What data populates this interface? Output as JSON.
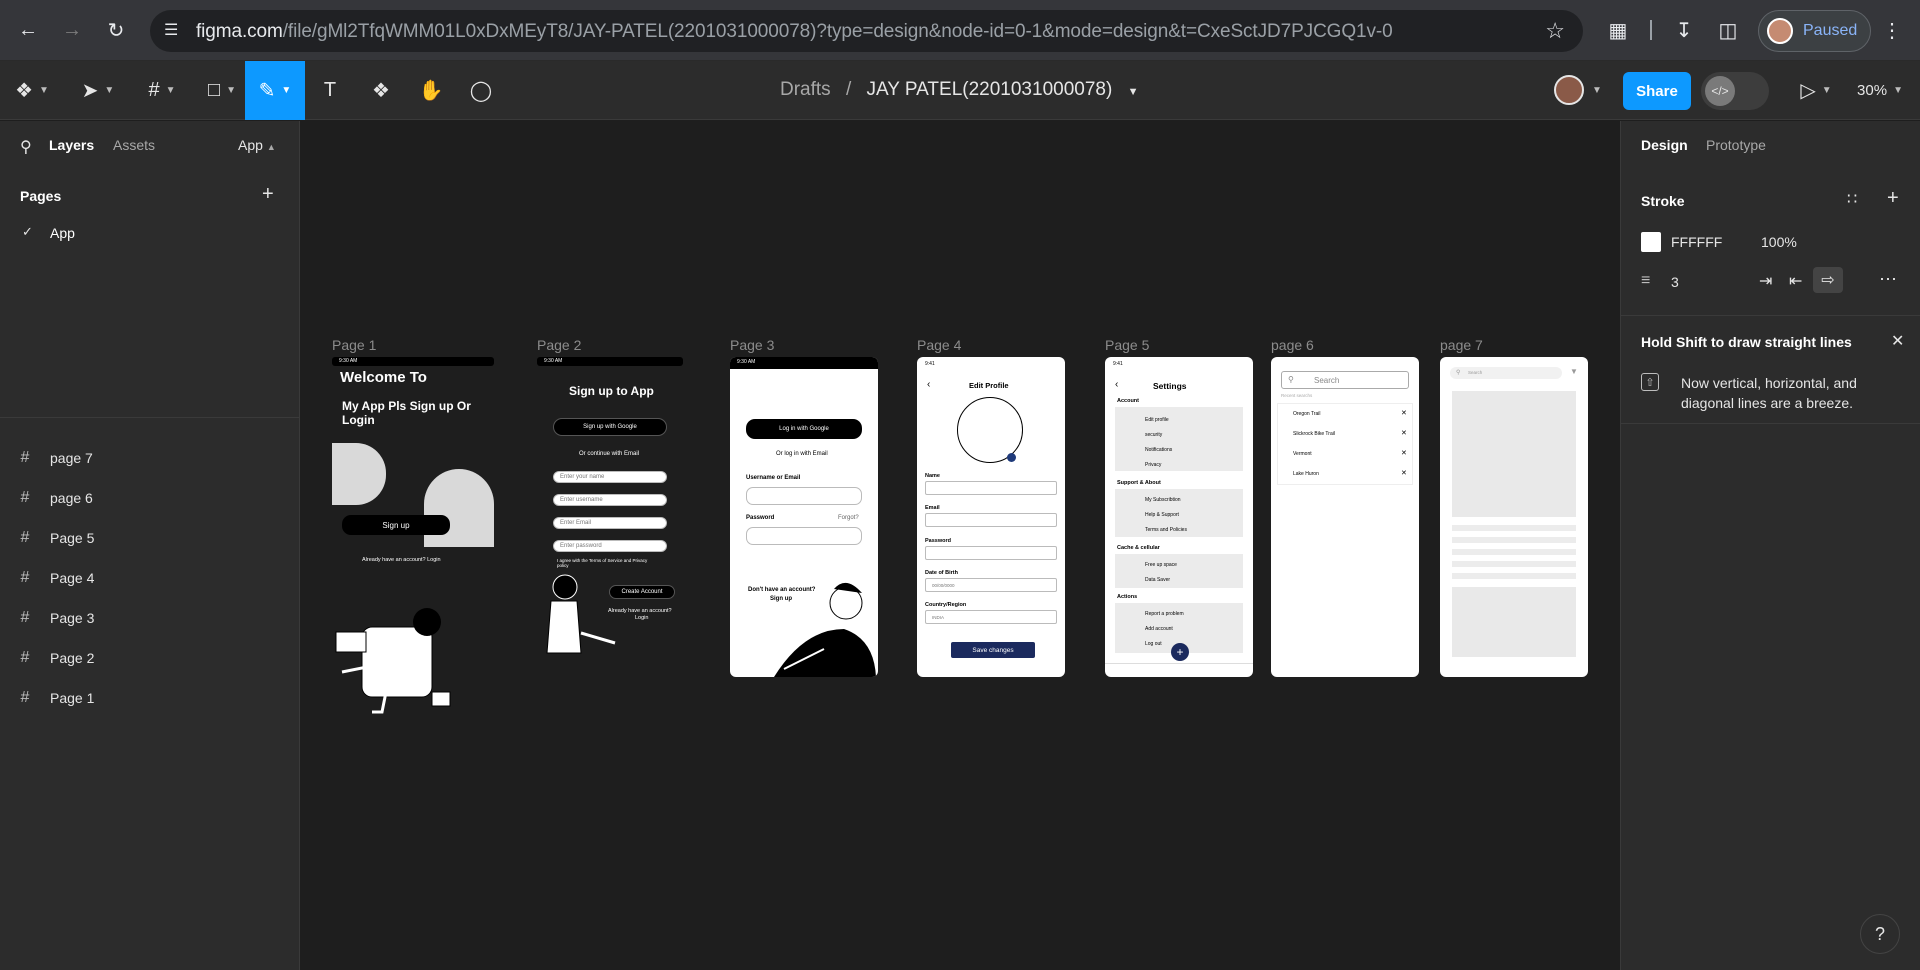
{
  "browser": {
    "url_main": "figma.com",
    "url_rest": "/file/gMl2TfqWMM01L0xDxMEyT8/JAY-PATEL(2201031000078)?type=design&node-id=0-1&mode=design&t=CxeSctJD7PJCGQ1v-0",
    "profile_status": "Paused"
  },
  "toolbar": {
    "breadcrumb_root": "Drafts",
    "breadcrumb_sep": "/",
    "file_name": "JAY PATEL(2201031000078)",
    "share_label": "Share",
    "zoom": "30%"
  },
  "left_panel": {
    "tab_layers": "Layers",
    "tab_assets": "Assets",
    "page_selector": "App",
    "pages_heading": "Pages",
    "current_page": "App",
    "layers": [
      "page 7",
      "page 6",
      "Page 5",
      "Page 4",
      "Page 3",
      "Page 2",
      "Page 1"
    ]
  },
  "right_panel": {
    "tab_design": "Design",
    "tab_prototype": "Prototype",
    "stroke_heading": "Stroke",
    "stroke_color": "FFFFFF",
    "stroke_opacity": "100%",
    "stroke_weight": "3",
    "hint_title": "Hold Shift to draw straight lines",
    "hint_body": "Now vertical, horizontal, and diagonal lines are a breeze."
  },
  "frames": {
    "labels": [
      "Page 1",
      "Page 2",
      "Page 3",
      "Page 4",
      "Page 5",
      "page 6",
      "page 7"
    ],
    "p1": {
      "time": "9:30 AM",
      "title": "Welcome To",
      "subtitle": "My App Pls Sign up Or Login",
      "signup": "Sign up",
      "footer": "Already have an account? Login"
    },
    "p2": {
      "time": "9:30 AM",
      "title": "Sign up to App",
      "google": "Sign up with Google",
      "or": "Or continue with Email",
      "f1": "Enter your name",
      "f2": "Enter username",
      "f3": "Enter Email",
      "f4": "Enter password",
      "terms": "I agree with the Terms of Service and Privacy policy",
      "create": "Create Account",
      "have": "Already have an account?",
      "login": "Login"
    },
    "p3": {
      "time": "9:30 AM",
      "google": "Log in with Google",
      "or": "Or log in with Email",
      "user": "Username or Email",
      "pass": "Password",
      "forgot": "Forgot?",
      "noacc": "Don't have an account?",
      "signup": "Sign up"
    },
    "p4": {
      "time": "9:41",
      "title": "Edit Profile",
      "name": "Name",
      "email": "Email",
      "password": "Password",
      "dob": "Date of Birth",
      "dob_val": "00/00/0000",
      "country": "Country/Region",
      "country_val": "INDIA",
      "save": "Save changes"
    },
    "p5": {
      "time": "9:41",
      "title": "Settings",
      "account": "Account",
      "items_account": [
        "Edit profile",
        "security",
        "Notifications",
        "Privacy"
      ],
      "support": "Support & About",
      "items_support": [
        "My Subscribtion",
        "Help & Support",
        "Terms and Policies"
      ],
      "cache": "Cache & cellular",
      "items_cache": [
        "Free up space",
        "Data Saver"
      ],
      "actions": "Actions",
      "items_actions": [
        "Report a problem",
        "Add account",
        "Log out"
      ]
    },
    "p6": {
      "search": "Search",
      "recent": "Recent searchs",
      "items": [
        "Oregon Trail",
        "Slickrock Bike Trail",
        "Vermont",
        "Lake Huron"
      ]
    },
    "p7": {
      "search": "Search"
    }
  }
}
